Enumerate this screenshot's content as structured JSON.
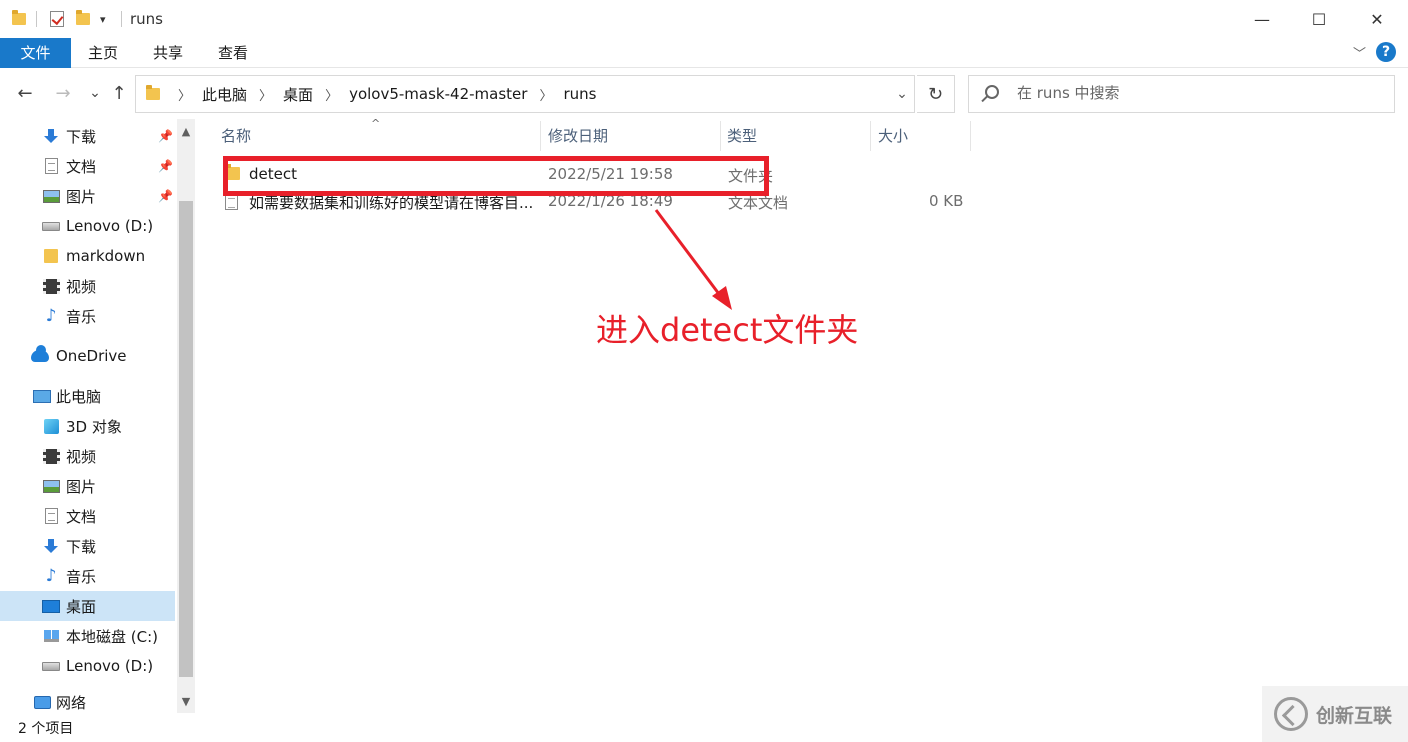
{
  "window": {
    "title": "runs",
    "minimize": "—",
    "maximize": "☐",
    "close": "✕"
  },
  "ribbon": {
    "tabs": [
      "文件",
      "主页",
      "共享",
      "查看"
    ],
    "collapse": "﹀",
    "help": "?"
  },
  "nav": {
    "back": "←",
    "forward": "→",
    "recent": "⌄",
    "up": "↑",
    "breadcrumbs": [
      "此电脑",
      "桌面",
      "yolov5-mask-42-master",
      "runs"
    ],
    "crumb_sep": "〉",
    "dropdown": "⌄",
    "refresh": "↻"
  },
  "search": {
    "placeholder": "在 runs 中搜索"
  },
  "sidebar": {
    "items": [
      {
        "label": "下载",
        "icon": "download-icon",
        "pinned": true
      },
      {
        "label": "文档",
        "icon": "document-icon",
        "pinned": true
      },
      {
        "label": "图片",
        "icon": "picture-icon",
        "pinned": true
      },
      {
        "label": "Lenovo (D:)",
        "icon": "drive-icon"
      },
      {
        "label": "markdown",
        "icon": "folder-icon"
      },
      {
        "label": "视频",
        "icon": "video-icon"
      },
      {
        "label": "音乐",
        "icon": "music-icon"
      },
      {
        "label": "OneDrive",
        "icon": "onedrive-icon"
      },
      {
        "label": "此电脑",
        "icon": "this-pc-icon"
      },
      {
        "label": "3D 对象",
        "icon": "3d-objects-icon"
      },
      {
        "label": "视频",
        "icon": "video-icon"
      },
      {
        "label": "图片",
        "icon": "picture-icon"
      },
      {
        "label": "文档",
        "icon": "document-icon"
      },
      {
        "label": "下载",
        "icon": "download-icon"
      },
      {
        "label": "音乐",
        "icon": "music-icon"
      },
      {
        "label": "桌面",
        "icon": "desktop-icon",
        "selected": true
      },
      {
        "label": "本地磁盘 (C:)",
        "icon": "windows-drive-icon"
      },
      {
        "label": "Lenovo (D:)",
        "icon": "drive-icon"
      },
      {
        "label": "网络",
        "icon": "network-icon"
      }
    ],
    "pin_glyph": "📌",
    "scroll_up": "▲",
    "scroll_down": "▼"
  },
  "file_list": {
    "columns": [
      "名称",
      "修改日期",
      "类型",
      "大小"
    ],
    "sort_glyph": "^",
    "rows": [
      {
        "name": "detect",
        "date": "2022/5/21 19:58",
        "type": "文件夹",
        "size": "",
        "icon": "folder-icon"
      },
      {
        "name": "如需要数据集和训练好的模型请在博客目...",
        "date": "2022/1/26 18:49",
        "type": "文本文档",
        "size": "0 KB",
        "icon": "text-file-icon"
      }
    ]
  },
  "annotation": {
    "text": "进入detect文件夹",
    "color": "#e8202a"
  },
  "status": {
    "item_count": "2 个项目"
  },
  "watermark": {
    "text": "创新互联"
  },
  "colors": {
    "accent": "#1979ca",
    "selected_bg": "#cce4f7"
  }
}
